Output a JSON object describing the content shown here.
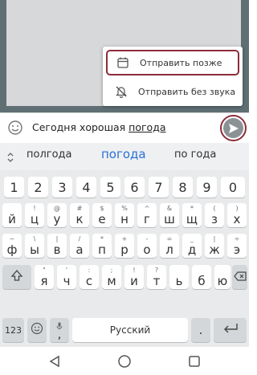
{
  "popup": {
    "send_later_label": "Отправить позже",
    "send_silent_label": "Отправить без звука"
  },
  "compose": {
    "text_plain": "Сегодня хорошая ",
    "text_underlined": "погода"
  },
  "suggestions": {
    "left": "полгода",
    "middle": "погода",
    "right": "по года"
  },
  "keyboard": {
    "number_row": [
      "1",
      "2",
      "3",
      "4",
      "5",
      "6",
      "7",
      "8",
      "9",
      "0"
    ],
    "row1": [
      {
        "letter": "й",
        "hint": ""
      },
      {
        "letter": "ц",
        "hint": "!"
      },
      {
        "letter": "у",
        "hint": "@"
      },
      {
        "letter": "к",
        "hint": "#"
      },
      {
        "letter": "е",
        "hint": "$"
      },
      {
        "letter": "н",
        "hint": "%"
      },
      {
        "letter": "г",
        "hint": "^"
      },
      {
        "letter": "ш",
        "hint": "&"
      },
      {
        "letter": "щ",
        "hint": "*"
      },
      {
        "letter": "з",
        "hint": "("
      },
      {
        "letter": "х",
        "hint": ")"
      }
    ],
    "row2": [
      {
        "letter": "ф",
        "hint": "~"
      },
      {
        "letter": "ы",
        "hint": "\\"
      },
      {
        "letter": "в",
        "hint": "|"
      },
      {
        "letter": "а",
        "hint": "/"
      },
      {
        "letter": "п",
        "hint": "*"
      },
      {
        "letter": "р",
        "hint": "+"
      },
      {
        "letter": "о",
        "hint": "-"
      },
      {
        "letter": "л",
        "hint": "="
      },
      {
        "letter": "д",
        "hint": "_"
      },
      {
        "letter": "ж",
        "hint": "|"
      },
      {
        "letter": "э",
        "hint": "÷"
      }
    ],
    "row3": [
      {
        "letter": "я",
        "hint": "\""
      },
      {
        "letter": "ч",
        "hint": "'"
      },
      {
        "letter": "с",
        "hint": ":"
      },
      {
        "letter": "м",
        "hint": ";"
      },
      {
        "letter": "и",
        "hint": "!"
      },
      {
        "letter": "т",
        "hint": "?"
      },
      {
        "letter": "ь",
        "hint": ""
      },
      {
        "letter": "б",
        "hint": ""
      },
      {
        "letter": "ю",
        "hint": ""
      }
    ],
    "symbols_key": "123",
    "space_label": "Русский",
    "comma_key": ",",
    "period_key": "."
  },
  "icons": {
    "calendar": "calendar-icon",
    "bell_off": "bell-off-icon",
    "emoji": "smiley-icon",
    "send": "send-icon",
    "collapse": "chevron-updown-icon",
    "shift": "shift-arrow-icon",
    "backspace": "backspace-icon",
    "enter": "enter-icon",
    "mic": "microphone-icon",
    "nav_back": "triangle-back-icon",
    "nav_home": "circle-home-icon",
    "nav_recent": "square-recent-icon"
  },
  "colors": {
    "highlight": "#8b2d3c",
    "suggestion_active": "#2b6fd6",
    "send_button": "#8c9294"
  }
}
